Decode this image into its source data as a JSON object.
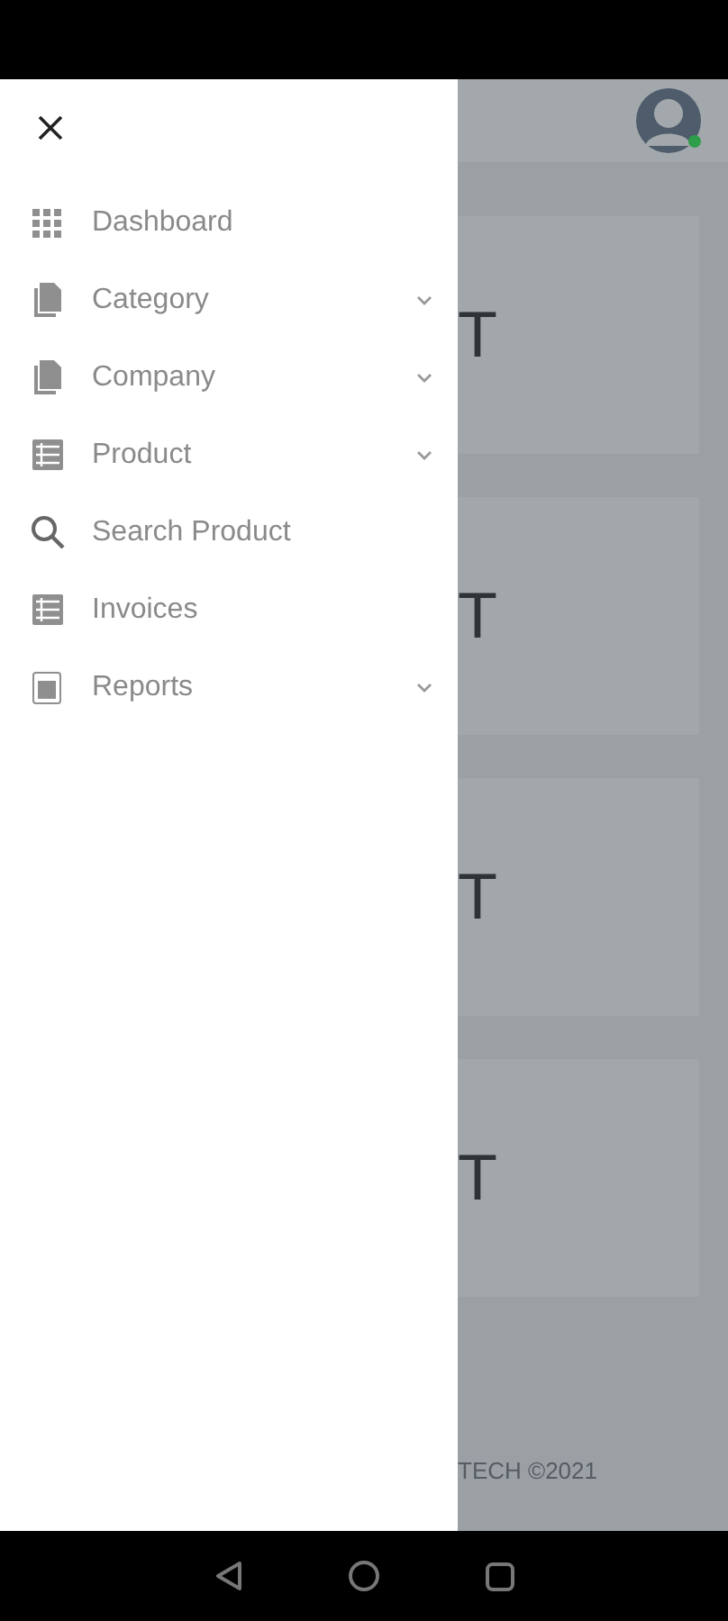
{
  "menu": [
    {
      "label": "Dashboard",
      "has_submenu": false
    },
    {
      "label": "Category",
      "has_submenu": true
    },
    {
      "label": "Company",
      "has_submenu": true
    },
    {
      "label": "Product",
      "has_submenu": true
    },
    {
      "label": "Search Product",
      "has_submenu": false
    },
    {
      "label": "Invoices",
      "has_submenu": false
    },
    {
      "label": "Reports",
      "has_submenu": true
    }
  ],
  "cards": [
    {
      "text": "T"
    },
    {
      "text": "T"
    },
    {
      "text": "T"
    },
    {
      "text": "T"
    }
  ],
  "footer": "TECH ©2021"
}
